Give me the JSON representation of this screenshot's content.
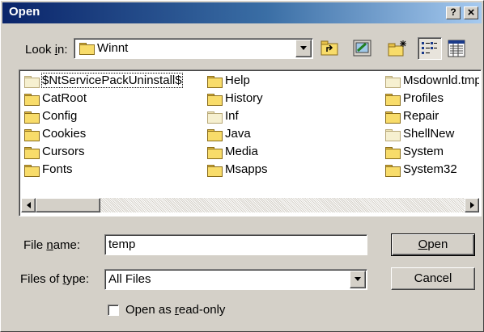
{
  "window": {
    "title": "Open"
  },
  "titlebar_buttons": {
    "help": "?",
    "close": "×"
  },
  "lookin": {
    "label_pre": "Look ",
    "label_u": "i",
    "label_post": "n:",
    "value": "Winnt"
  },
  "toolbar_icons": [
    "up-one-level-icon",
    "desktop-icon",
    "new-folder-icon",
    "list-view-icon",
    "details-view-icon"
  ],
  "files": {
    "col1": [
      "$NtServicePackUninstall$",
      "CatRoot",
      "Config",
      "Cookies",
      "Cursors",
      "Fonts"
    ],
    "col2": [
      "Help",
      "History",
      "Inf",
      "Java",
      "Media",
      "Msapps"
    ],
    "col3": [
      "Msdownld.tmp",
      "Profiles",
      "Repair",
      "ShellNew",
      "System",
      "System32"
    ]
  },
  "filename": {
    "label_pre": "File ",
    "label_u": "n",
    "label_post": "ame:",
    "value": "temp"
  },
  "filetype": {
    "label_pre": "Files of ",
    "label_u": "t",
    "label_post": "ype:",
    "value": "All Files"
  },
  "buttons": {
    "open_u": "O",
    "open_rest": "pen",
    "cancel": "Cancel"
  },
  "readonly": {
    "label_pre": "Open as ",
    "label_u": "r",
    "label_post": "ead-only",
    "checked": false
  }
}
